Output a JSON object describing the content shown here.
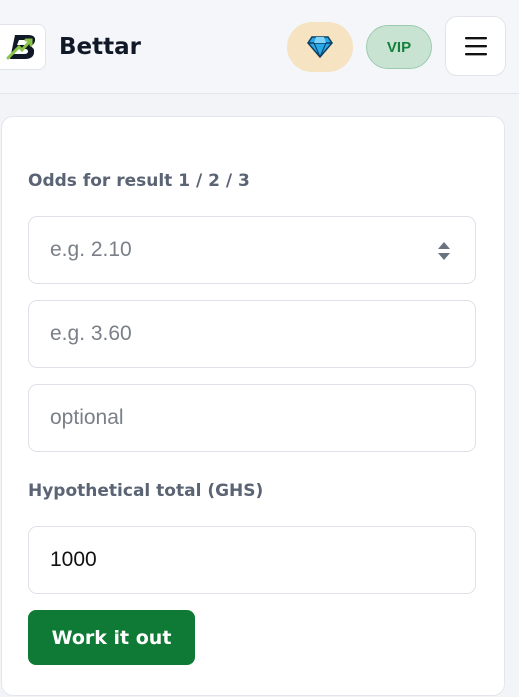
{
  "header": {
    "brand": "Bettar",
    "logo_icon": "bettar-logo-icon",
    "gem_icon": "diamond-icon",
    "vip_label": "VIP",
    "menu_icon": "hamburger-menu-icon",
    "menu_glyph": "☰"
  },
  "form": {
    "odds_label": "Odds for result 1 / 2 / 3",
    "odds1": {
      "placeholder": "e.g. 2.10",
      "value": ""
    },
    "odds2": {
      "placeholder": "e.g. 3.60",
      "value": ""
    },
    "odds3": {
      "placeholder": "optional",
      "value": ""
    },
    "total_label": "Hypothetical total (GHS)",
    "total": {
      "value": "1000"
    },
    "submit_label": "Work it out"
  },
  "colors": {
    "accent": "#0f7a35",
    "vip_bg": "#c9e3d2",
    "gem_bg": "#f5e3c2"
  }
}
